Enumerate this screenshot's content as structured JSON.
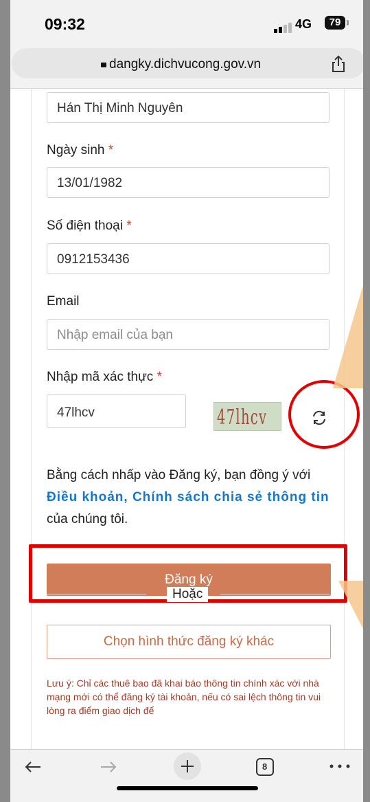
{
  "status": {
    "time": "09:32",
    "network": "4G",
    "battery": "79"
  },
  "browser": {
    "url": "dangky.dichvucong.gov.vn"
  },
  "form": {
    "name_value": "Hán Thị Minh Nguyên",
    "dob_label": "Ngày sinh",
    "dob_value": "13/01/1982",
    "phone_label": "Số điện thoại",
    "phone_value": "0912153436",
    "email_label": "Email",
    "email_placeholder": "Nhập email của bạn",
    "captcha_label": "Nhập mã xác thực",
    "captcha_value": "47lhcv",
    "captcha_image_text": "47lhcv",
    "required_mark": "*"
  },
  "terms": {
    "prefix": "Bằng cách nhấp vào Đăng ký, bạn đồng ý với ",
    "link": "Điều khoản, Chính sách chia sẻ thông tin",
    "suffix": " của chúng tôi."
  },
  "buttons": {
    "register": "Đăng ký",
    "or": "Hoặc",
    "alt": "Chọn hình thức đăng ký khác"
  },
  "note": "Lưu ý: Chỉ các thuê bao đã khai báo thông tin chính xác với nhà mạng mới có thể đăng ký tài khoản, nếu có sai lệch thông tin vui lòng ra điểm giao dịch để",
  "toolbar": {
    "tabs_count": "8"
  },
  "colors": {
    "accent": "#d17d5a",
    "highlight": "#e10000",
    "link": "#1577c9",
    "arrow": "#f6c58d"
  }
}
